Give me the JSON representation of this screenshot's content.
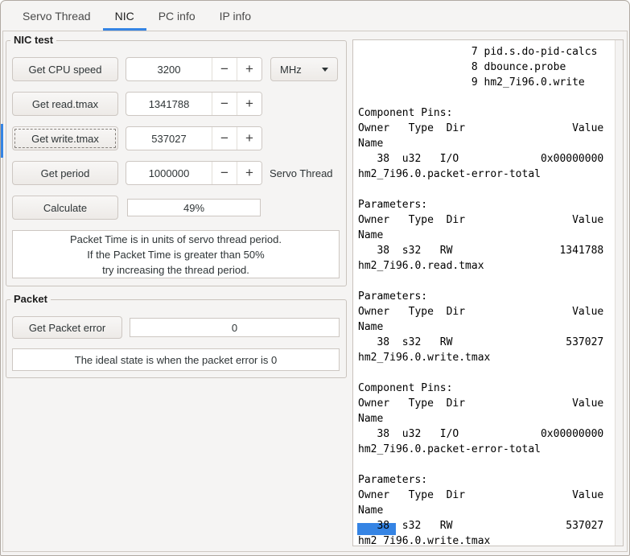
{
  "controls": {
    "minus": "−",
    "plus": "+"
  },
  "tabs": [
    {
      "label": "Servo Thread"
    },
    {
      "label": "NIC"
    },
    {
      "label": "PC info"
    },
    {
      "label": "IP info"
    }
  ],
  "nic_test": {
    "legend": "NIC test",
    "rows": [
      {
        "button": "Get CPU speed",
        "value": "3200",
        "combo": "MHz"
      },
      {
        "button": "Get read.tmax",
        "value": "1341788"
      },
      {
        "button": "Get write.tmax",
        "value": "537027"
      },
      {
        "button": "Get period",
        "value": "1000000",
        "suffix": "Servo Thread"
      }
    ],
    "calculate": "Calculate",
    "progress_text": "49%",
    "info_lines": [
      "Packet Time is in units of servo thread period.",
      "If the Packet Time is greater than 50%",
      "try increasing the thread period."
    ]
  },
  "packet": {
    "legend": "Packet",
    "button": "Get Packet error",
    "value": "0",
    "info": "The ideal state is when the packet error is 0"
  },
  "accent_color": "#3584e4",
  "output": {
    "lines": [
      "                  7 pid.s.do-pid-calcs",
      "                  8 dbounce.probe",
      "                  9 hm2_7i96.0.write",
      "",
      "Component Pins:",
      "Owner   Type  Dir                 Value",
      "Name",
      "   38  u32   I/O             0x00000000",
      "hm2_7i96.0.packet-error-total",
      "",
      "Parameters:",
      "Owner   Type  Dir                 Value",
      "Name",
      "   38  s32   RW                 1341788",
      "hm2_7i96.0.read.tmax",
      "",
      "Parameters:",
      "Owner   Type  Dir                 Value",
      "Name",
      "   38  s32   RW                  537027",
      "hm2_7i96.0.write.tmax",
      "",
      "Component Pins:",
      "Owner   Type  Dir                 Value",
      "Name",
      "   38  u32   I/O             0x00000000",
      "hm2_7i96.0.packet-error-total",
      "",
      "Parameters:",
      "Owner   Type  Dir                 Value",
      "Name",
      "   38  s32   RW                  537027",
      "hm2_7i96.0.write.tmax"
    ]
  }
}
